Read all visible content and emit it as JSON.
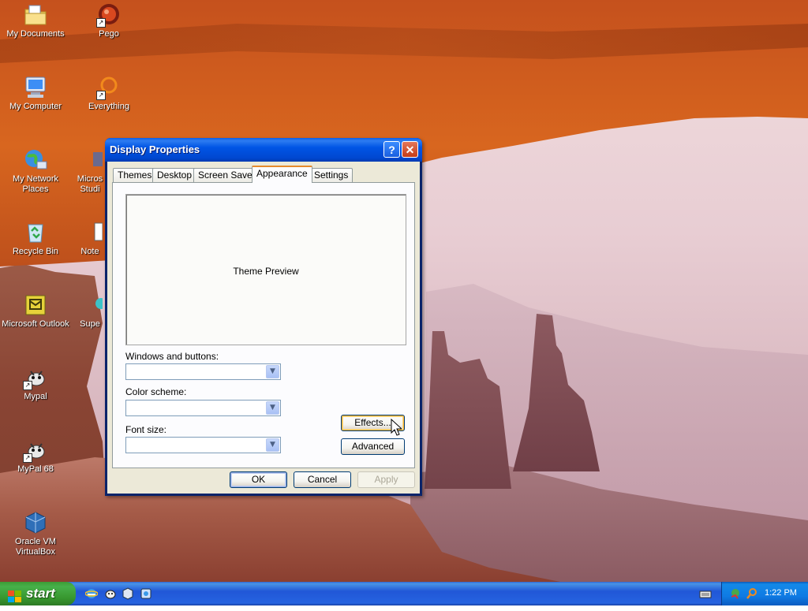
{
  "desktop": {
    "icons": [
      {
        "label": "My Documents",
        "icon": "folder-documents-icon"
      },
      {
        "label": "Pego",
        "icon": "pego-shortcut-icon"
      },
      {
        "label": "My Computer",
        "icon": "computer-icon"
      },
      {
        "label": "Everything",
        "icon": "everything-search-icon"
      },
      {
        "label": "My Network Places",
        "icon": "network-places-icon"
      },
      {
        "label": "Micros Studi",
        "icon": "studio-shortcut-icon"
      },
      {
        "label": "Recycle Bin",
        "icon": "recycle-bin-icon"
      },
      {
        "label": "Note",
        "icon": "notepad-shortcut-icon"
      },
      {
        "label": "Microsoft Outlook",
        "icon": "outlook-icon"
      },
      {
        "label": "Supe",
        "icon": "super-shortcut-icon"
      },
      {
        "label": "Mypal",
        "icon": "mypal-icon"
      },
      {
        "label": "MyPal 68",
        "icon": "mypal68-icon"
      },
      {
        "label": "Oracle VM VirtualBox",
        "icon": "virtualbox-icon"
      }
    ]
  },
  "dialog": {
    "title": "Display Properties",
    "help_label": "?",
    "close_label": "✕",
    "tabs": [
      {
        "label": "Themes",
        "active": false
      },
      {
        "label": "Desktop",
        "active": false
      },
      {
        "label": "Screen Saver",
        "active": false
      },
      {
        "label": "Appearance",
        "active": true
      },
      {
        "label": "Settings",
        "active": false
      }
    ],
    "preview_text": "Theme Preview",
    "windows_buttons_label": "Windows and buttons:",
    "windows_buttons_value": "",
    "color_scheme_label": "Color scheme:",
    "color_scheme_value": "",
    "font_size_label": "Font size:",
    "font_size_value": "",
    "effects_label": "Effects...",
    "advanced_label": "Advanced",
    "ok_label": "OK",
    "cancel_label": "Cancel",
    "apply_label": "Apply"
  },
  "taskbar": {
    "start_label": "start",
    "quick_launch": [
      "internet-explorer-icon",
      "mypal-icon",
      "virtualbox-icon",
      "media-icon"
    ],
    "tray_icons": [
      "keyboard-icon",
      "network-icon",
      "search-icon"
    ],
    "clock": "1:22 PM"
  },
  "colors": {
    "titlebar": "#0055e5",
    "taskbar": "#245edb",
    "start_button": "#3c9b36",
    "dialog_face": "#ece9d8",
    "active_tab_accent": "#e68b2c"
  }
}
